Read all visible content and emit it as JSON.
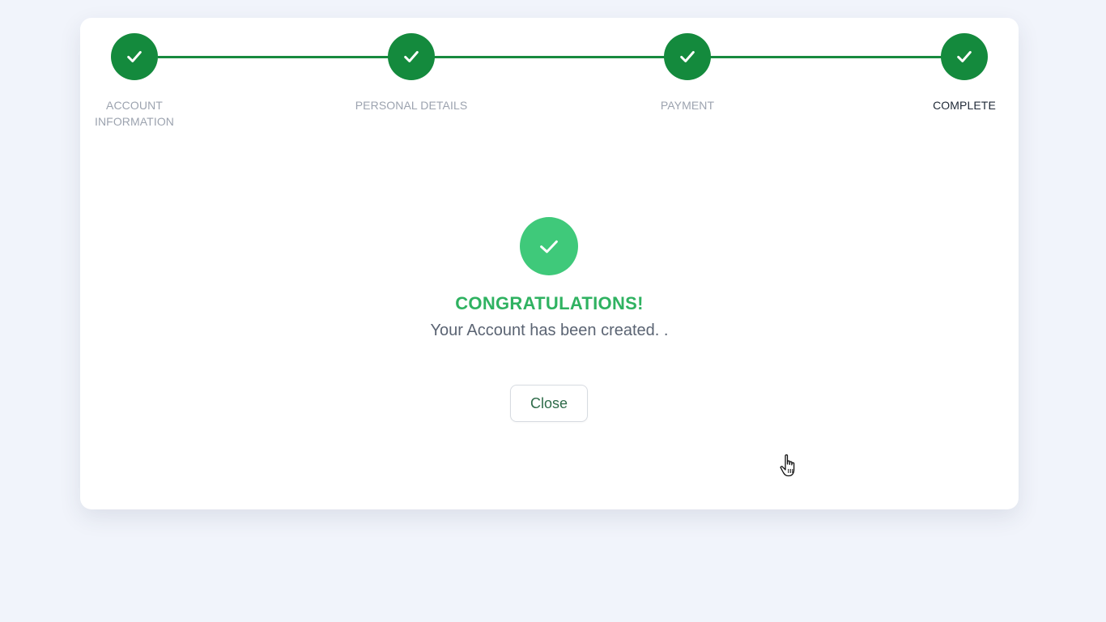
{
  "stepper": {
    "steps": [
      {
        "label_line1": "ACCOUNT",
        "label_line2": "INFORMATION",
        "status": "completed"
      },
      {
        "label_line1": "PERSONAL DETAILS",
        "label_line2": "",
        "status": "completed"
      },
      {
        "label_line1": "PAYMENT",
        "label_line2": "",
        "status": "completed"
      },
      {
        "label_line1": "COMPLETE",
        "label_line2": "",
        "status": "current"
      }
    ],
    "progress": 1.0
  },
  "result": {
    "title": "CONGRATULATIONS!",
    "message": "Your Account has been created. ."
  },
  "actions": {
    "close_label": "Close"
  },
  "colors": {
    "step_green": "#148a3d",
    "success_green": "#3fc97a",
    "title_green": "#2fb261",
    "background": "#f1f4fb"
  },
  "icons": {
    "step_icon": "checkmark-icon",
    "success_icon": "checkmark-icon",
    "cursor": "hand-pointer-cursor"
  }
}
